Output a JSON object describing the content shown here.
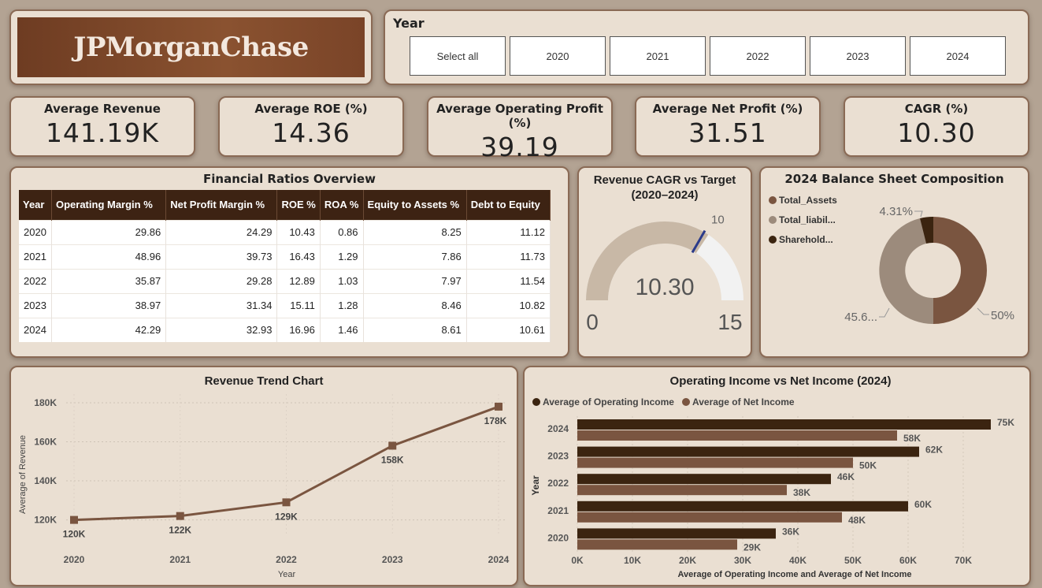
{
  "logo": {
    "text": "JPMorganChase"
  },
  "year_slicer": {
    "title": "Year",
    "options": [
      "Select all",
      "2020",
      "2021",
      "2022",
      "2023",
      "2024"
    ]
  },
  "kpis": [
    {
      "label": "Average Revenue",
      "value": "141.19K"
    },
    {
      "label": "Average ROE (%)",
      "value": "14.36"
    },
    {
      "label": "Average Operating Profit (%)",
      "value": "39.19"
    },
    {
      "label": "Average Net Profit (%)",
      "value": "31.51"
    },
    {
      "label": "CAGR (%)",
      "value": "10.30"
    }
  ],
  "ratios": {
    "title": "Financial Ratios Overview",
    "columns": [
      "Year",
      "Operating Margin %",
      "Net Profit Margin %",
      "ROE %",
      "ROA %",
      "Equity to Assets %",
      "Debt to Equity"
    ],
    "rows": [
      [
        "2020",
        "29.86",
        "24.29",
        "10.43",
        "0.86",
        "8.25",
        "11.12"
      ],
      [
        "2021",
        "48.96",
        "39.73",
        "16.43",
        "1.29",
        "7.86",
        "11.73"
      ],
      [
        "2022",
        "35.87",
        "29.28",
        "12.89",
        "1.03",
        "7.97",
        "11.54"
      ],
      [
        "2023",
        "38.97",
        "31.34",
        "15.11",
        "1.28",
        "8.46",
        "10.82"
      ],
      [
        "2024",
        "42.29",
        "32.93",
        "16.96",
        "1.46",
        "8.61",
        "10.61"
      ]
    ]
  },
  "gauge": {
    "title_line1": "Revenue CAGR vs Target",
    "title_line2": "(2020–2024)",
    "value": 10.3,
    "value_label": "10.30",
    "min": 0,
    "min_label": "0",
    "max": 15,
    "max_label": "15",
    "target": 10,
    "target_label": "10",
    "colors": {
      "fill": "#c8b8a6",
      "track": "#f2f2f2",
      "target": "#2a3a8a"
    }
  },
  "donut": {
    "title": "2024 Balance Sheet Composition",
    "legend": [
      {
        "label": "Total_Assets",
        "color": "#7a5540"
      },
      {
        "label": "Total_liabil...",
        "color": "#9c8b7c"
      },
      {
        "label": "Sharehold...",
        "color": "#3b2410"
      }
    ],
    "labels": {
      "assets": "50%",
      "liabilities": "45.6...",
      "equity": "4.31%"
    }
  },
  "chart_data": [
    {
      "type": "line",
      "title": "Revenue Trend Chart",
      "xlabel": "Year",
      "ylabel": "Average of Revenue",
      "x": [
        "2020",
        "2021",
        "2022",
        "2023",
        "2024"
      ],
      "values": [
        120,
        122,
        129,
        158,
        178
      ],
      "data_labels": [
        "120K",
        "122K",
        "129K",
        "158K",
        "178K"
      ],
      "ylim": [
        115,
        182
      ],
      "yticks": [
        120,
        140,
        160,
        180
      ],
      "ytick_labels": [
        "120K",
        "140K",
        "160K",
        "180K"
      ],
      "color": "#7a5540",
      "grid": true
    },
    {
      "type": "bar",
      "orientation": "horizontal",
      "title": "Operating Income vs Net Income (2024)",
      "xlabel": "Average of Operating Income and Average of Net Income",
      "ylabel": "Year",
      "categories": [
        "2024",
        "2023",
        "2022",
        "2021",
        "2020"
      ],
      "series": [
        {
          "name": "Average of Operating Income",
          "color": "#3b2410",
          "values": [
            75,
            62,
            46,
            60,
            36
          ],
          "labels": [
            "75K",
            "62K",
            "46K",
            "60K",
            "36K"
          ]
        },
        {
          "name": "Average of Net Income",
          "color": "#7a5540",
          "values": [
            58,
            50,
            38,
            48,
            29
          ],
          "labels": [
            "58K",
            "50K",
            "38K",
            "48K",
            "29K"
          ]
        }
      ],
      "xlim": [
        0,
        75
      ],
      "xticks": [
        0,
        10,
        20,
        30,
        40,
        50,
        60,
        70
      ],
      "xtick_labels": [
        "0K",
        "10K",
        "20K",
        "30K",
        "40K",
        "50K",
        "60K",
        "70K"
      ],
      "legend_position": "top-left"
    }
  ]
}
